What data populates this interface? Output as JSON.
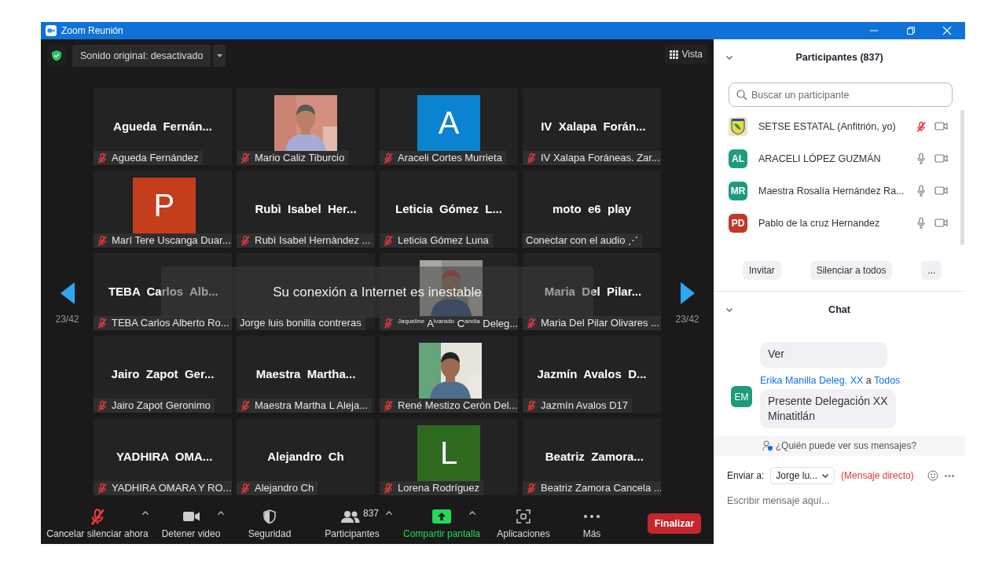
{
  "window": {
    "title": "Zoom Reunión"
  },
  "meeting_bar": {
    "original_sound": "Sonido original: desactivado",
    "view": "Vista"
  },
  "pager": {
    "left": "23/42",
    "right": "23/42"
  },
  "tiles": [
    {
      "kind": "name",
      "center_name": "Agueda  Fernán...",
      "label": "Agueda Fernández",
      "muted": true
    },
    {
      "label": "Mario Caliz Tiburcio",
      "muted": true
    },
    {
      "kind": "avatar",
      "letter": "A",
      "color": "#0a84d0",
      "label": "Araceli Cortes Murrieta",
      "muted": true
    },
    {
      "kind": "name",
      "center_name": "IV  Xalapa  Forán...",
      "label": "IV Xalapa Foráneas. Zar...",
      "muted": true
    },
    {
      "kind": "avatar",
      "letter": "P",
      "color": "#c43e1c",
      "label": "Marí Tere Uscanga Duar...",
      "muted": true
    },
    {
      "kind": "name",
      "center_name": "Rubì  Isabel  Her...",
      "label": "Rubì Isabel Hernàndez ...",
      "muted": true
    },
    {
      "kind": "name",
      "center_name": "Leticia  Gómez  L...",
      "label": "Leticia Gómez Luna",
      "muted": true
    },
    {
      "kind": "name",
      "center_name": "moto  e6  play",
      "label": "Conectar con el audio ⋰",
      "muted": false
    },
    {
      "kind": "name",
      "center_name": "TEBA  Carlos  Alb...",
      "label": "TEBA Carlos Alberto Ro...",
      "muted": true
    },
    {
      "kind": "blank",
      "label": "Jorge luis bonilla contreras",
      "muted": false
    },
    {
      "label": "$^{Jaqueline}$ A$^{lvarado}$ C$^{andia}$ Deleg...",
      "muted": true
    },
    {
      "kind": "name",
      "center_name": "Maria  Del  Pilar...",
      "label": "Maria Del Pilar Olivares ...",
      "muted": true
    },
    {
      "kind": "name",
      "center_name": "Jairo  Zapot  Ger...",
      "label": "Jairo Zapot Geronimo",
      "muted": true
    },
    {
      "kind": "name",
      "center_name": "Maestra  Martha...",
      "label": "Maestra Martha L Aleja...",
      "muted": true
    },
    {
      "label": "René Mestizo Cerón Del...",
      "muted": true
    },
    {
      "kind": "name",
      "center_name": "Jazmín  Avalos  D...",
      "label": "Jazmín Avalos D17",
      "muted": true
    },
    {
      "kind": "name",
      "center_name": "YADHIRA  OMA...",
      "label": "YADHIRA OMARA Y RO...",
      "muted": true
    },
    {
      "kind": "name",
      "center_name": "Alejandro  Ch",
      "label": "Alejandro Ch",
      "muted": true
    },
    {
      "kind": "avatar",
      "letter": "L",
      "color": "#2e6b1f",
      "label": "Lorena Rodríguez",
      "muted": true
    },
    {
      "kind": "name",
      "center_name": "Beatriz  Zamora...",
      "label": "Beatriz Zamora Cancela ...",
      "muted": true
    }
  ],
  "notice": "Su conexión a Internet es inestable",
  "toolbar": {
    "items": [
      {
        "kind": "mic_off",
        "label": "Cancelar silenciar ahora",
        "caret": true
      },
      {
        "kind": "video",
        "label": "Detener video",
        "caret": true
      },
      {
        "kind": "security",
        "label": "Seguridad",
        "caret": false
      },
      {
        "kind": "participants",
        "label": "Participantes",
        "count": "837",
        "caret": true
      },
      {
        "kind": "share",
        "label": "Compartir pantalla",
        "caret": true
      },
      {
        "kind": "apps",
        "label": "Aplicaciones",
        "caret": false
      },
      {
        "kind": "more",
        "label": "Más",
        "caret": false
      }
    ],
    "end": "Finalizar"
  },
  "participants_panel": {
    "title": "Participantes (837)",
    "search_placeholder": "Buscar un participante",
    "rows": [
      {
        "kind": "logo",
        "name": "SETSE ESTATAL (Anfitrión, yo)",
        "muted": true
      },
      {
        "kind": "initials",
        "initials": "AL",
        "color": "#1e9b7f",
        "name": "ARACELI LÓPEZ GUZMÁN",
        "muted": false
      },
      {
        "kind": "initials",
        "initials": "MR",
        "color": "#1e9b7f",
        "name": "Maestra Rosalía Hernández Ra...",
        "muted": false
      },
      {
        "kind": "initials",
        "initials": "PD",
        "color": "#c0392b",
        "name": "Pablo de la cruz Hernandez",
        "muted": false
      }
    ],
    "buttons": [
      "Invitar",
      "Silenciar a todos",
      "..."
    ]
  },
  "chat": {
    "title": "Chat",
    "messages": [
      {
        "text": "Ver"
      },
      {
        "sender": "Erika Manilla Deleg. XX",
        "connector": "a",
        "recipient": "Todos",
        "initials": "EM",
        "color": "#1e9b7f",
        "text": "Presente Delegación XX\nMinatitlán"
      }
    ],
    "visibility": "¿Quién puede ver sus mensajes?",
    "send_to_label": "Enviar a:",
    "send_to": "Jorge lu...",
    "direct": "(Mensaje directo)",
    "placeholder": "Escribir mensaje aquí..."
  }
}
